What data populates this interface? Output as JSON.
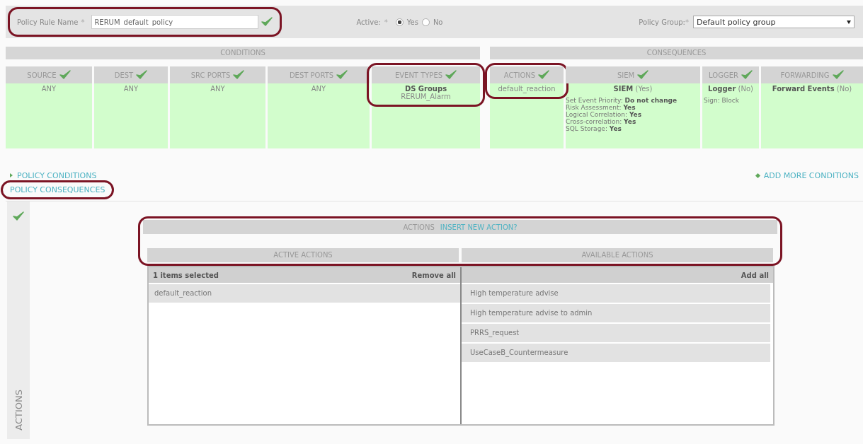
{
  "policy_name": {
    "label": "Policy Rule Name",
    "required_mark": "*",
    "value": "RERUM_default_policy",
    "valid": true,
    "highlighted": true
  },
  "active": {
    "label": "Active:",
    "required_mark": "*",
    "options": [
      {
        "label": "Yes",
        "selected": true
      },
      {
        "label": "No",
        "selected": false
      }
    ]
  },
  "policy_group": {
    "label": "Policy Group:",
    "required_mark": "*",
    "value": "Default policy group"
  },
  "conditions": {
    "title": "CONDITIONS",
    "columns": [
      {
        "header": "SOURCE",
        "checked": true,
        "highlighted": false,
        "lines": [
          "ANY"
        ]
      },
      {
        "header": "DEST",
        "checked": true,
        "highlighted": false,
        "lines": [
          "ANY"
        ]
      },
      {
        "header": "SRC PORTS",
        "checked": true,
        "highlighted": false,
        "lines": [
          "ANY"
        ]
      },
      {
        "header": "DEST PORTS",
        "checked": true,
        "highlighted": false,
        "lines": [
          "ANY"
        ]
      },
      {
        "header": "EVENT TYPES",
        "checked": true,
        "highlighted": true,
        "lines": [
          "**DS Groups**",
          "RERUM_Alarm"
        ]
      }
    ]
  },
  "consequences": {
    "title": "CONSEQUENCES",
    "columns": [
      {
        "header": "ACTIONS",
        "checked": true,
        "highlighted": true,
        "lines": [
          "default_reaction"
        ]
      },
      {
        "header": "SIEM",
        "checked": true,
        "highlighted": false,
        "lines": [
          "**SIEM** (Yes)"
        ],
        "details": [
          "Set Event Priority: **Do not change**",
          "Risk Assessment: **Yes**",
          "Logical Correlation: **Yes**",
          "Cross-correlation: **Yes**",
          "SQL Storage: **Yes**"
        ]
      },
      {
        "header": "LOGGER",
        "checked": true,
        "highlighted": false,
        "lines": [
          "**Logger** (No)"
        ],
        "details": [
          "Sign: Block"
        ]
      },
      {
        "header": "FORWARDING",
        "checked": true,
        "highlighted": false,
        "lines": [
          "**Forward Events** (No)"
        ]
      }
    ]
  },
  "links": {
    "policy_conditions": {
      "label": "POLICY CONDITIONS",
      "highlighted": false
    },
    "add_more": {
      "label": "ADD MORE CONDITIONS"
    },
    "policy_consequences": {
      "label": "POLICY CONSEQUENCES",
      "highlighted": true
    }
  },
  "side_tab": {
    "label": "ACTIONS",
    "valid": true
  },
  "actions": {
    "title": "ACTIONS",
    "insert_link": "INSERT NEW ACTION?",
    "highlighted": true,
    "active": {
      "title": "ACTIVE ACTIONS",
      "count": "1 items selected",
      "button": "Remove all",
      "items": [
        "default_reaction"
      ]
    },
    "available": {
      "title": "AVAILABLE ACTIONS",
      "button": "Add all",
      "items": [
        "High temperature advise",
        "High temperature advise to admin",
        "PRRS_request",
        "UseCaseB_Countermeasure"
      ]
    }
  }
}
